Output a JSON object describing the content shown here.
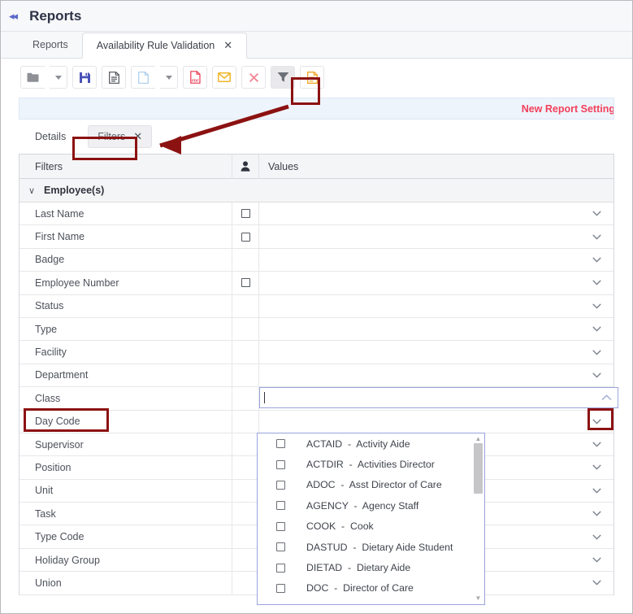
{
  "header": {
    "collapse_icon": "collapse-left-icon",
    "title": "Reports"
  },
  "tabs": [
    {
      "label": "Reports",
      "active": false,
      "closable": false
    },
    {
      "label": "Availability Rule Validation",
      "active": true,
      "closable": true,
      "close_glyph": "✕"
    }
  ],
  "toolbar": {
    "buttons": [
      {
        "name": "open-folder-button",
        "icon": "folder-icon",
        "color": "#8e9096",
        "caret": true
      },
      {
        "name": "save-button",
        "icon": "save-disk-icon",
        "color": "#4a52b8",
        "caret": false
      },
      {
        "name": "report-document-button",
        "icon": "document-lines-icon",
        "color": "#4d5058",
        "caret": false
      },
      {
        "name": "new-page-button",
        "icon": "blank-page-icon",
        "color": "#a9cdec",
        "caret": true
      },
      {
        "name": "export-pdf-button",
        "icon": "pdf-icon",
        "color": "#e8374f",
        "caret": false
      },
      {
        "name": "email-button",
        "icon": "envelope-icon",
        "color": "#f0b42a",
        "caret": false
      },
      {
        "name": "close-report-button",
        "icon": "x-icon",
        "color": "#f1808f",
        "caret": false
      },
      {
        "name": "filter-funnel-button",
        "icon": "funnel-icon",
        "color": "#6c7077",
        "caret": false,
        "highlighted": true,
        "annotated": true
      },
      {
        "name": "orange-document-button",
        "icon": "document-orange-icon",
        "color": "#f0a62a",
        "caret": false
      }
    ]
  },
  "notice": {
    "text": "New Report Setting"
  },
  "subtabs": [
    {
      "label": "Details",
      "active": false,
      "closable": false,
      "annotated": false
    },
    {
      "label": "Filters",
      "active": true,
      "closable": true,
      "close_glyph": "✕",
      "annotated": true
    }
  ],
  "filters_table": {
    "columns": {
      "filters": "Filters",
      "person_icon": "person-icon",
      "values": "Values"
    },
    "group": {
      "label": "Employee(s)",
      "expanded": true,
      "chevron": "∨"
    },
    "rows": [
      {
        "label": "Last Name",
        "checkbox": true,
        "value": "",
        "chevron": true
      },
      {
        "label": "First Name",
        "checkbox": true,
        "value": "",
        "chevron": true
      },
      {
        "label": "Badge",
        "checkbox": false,
        "value": "",
        "chevron": true
      },
      {
        "label": "Employee Number",
        "checkbox": true,
        "value": "",
        "chevron": true
      },
      {
        "label": "Status",
        "checkbox": false,
        "value": "",
        "chevron": true
      },
      {
        "label": "Type",
        "checkbox": false,
        "value": "",
        "chevron": true
      },
      {
        "label": "Facility",
        "checkbox": false,
        "value": "",
        "chevron": true
      },
      {
        "label": "Department",
        "checkbox": false,
        "value": "",
        "chevron": true
      },
      {
        "label": "Class",
        "checkbox": false,
        "value": "",
        "chevron": false,
        "editing": true,
        "annotated": true
      },
      {
        "label": "Day Code",
        "checkbox": false,
        "value": "",
        "chevron": true
      },
      {
        "label": "Supervisor",
        "checkbox": false,
        "value": "",
        "chevron": true
      },
      {
        "label": "Position",
        "checkbox": false,
        "value": "",
        "chevron": true
      },
      {
        "label": "Unit",
        "checkbox": false,
        "value": "",
        "chevron": true
      },
      {
        "label": "Task",
        "checkbox": false,
        "value": "",
        "chevron": true
      },
      {
        "label": "Type Code",
        "checkbox": false,
        "value": "",
        "chevron": true
      },
      {
        "label": "Holiday Group",
        "checkbox": false,
        "value": "",
        "chevron": true
      },
      {
        "label": "Union",
        "checkbox": false,
        "value": "",
        "chevron": true
      }
    ]
  },
  "class_editor": {
    "value": "",
    "collapse_chevron": "chevron-up-icon",
    "annotated": true
  },
  "class_dropdown": {
    "options": [
      {
        "code": "ACTAID",
        "name": "Activity Aide",
        "checked": false
      },
      {
        "code": "ACTDIR",
        "name": "Activities Director",
        "checked": false
      },
      {
        "code": "ADOC",
        "name": "Asst Director of Care",
        "checked": false
      },
      {
        "code": "AGENCY",
        "name": "Agency Staff",
        "checked": false
      },
      {
        "code": "COOK",
        "name": "Cook",
        "checked": false
      },
      {
        "code": "DASTUD",
        "name": "Dietary Aide Student",
        "checked": false
      },
      {
        "code": "DIETAD",
        "name": "Dietary Aide",
        "checked": false
      },
      {
        "code": "DOC",
        "name": "Director of Care",
        "checked": false
      }
    ],
    "separator": "-",
    "scroll_up_glyph": "▲",
    "scroll_down_glyph": "▼"
  },
  "annotations": {
    "box_color": "#8c1212",
    "arrow_color": "#8c1212",
    "arrow_from": "filter-funnel-button",
    "arrow_to": "filters-subtab"
  }
}
